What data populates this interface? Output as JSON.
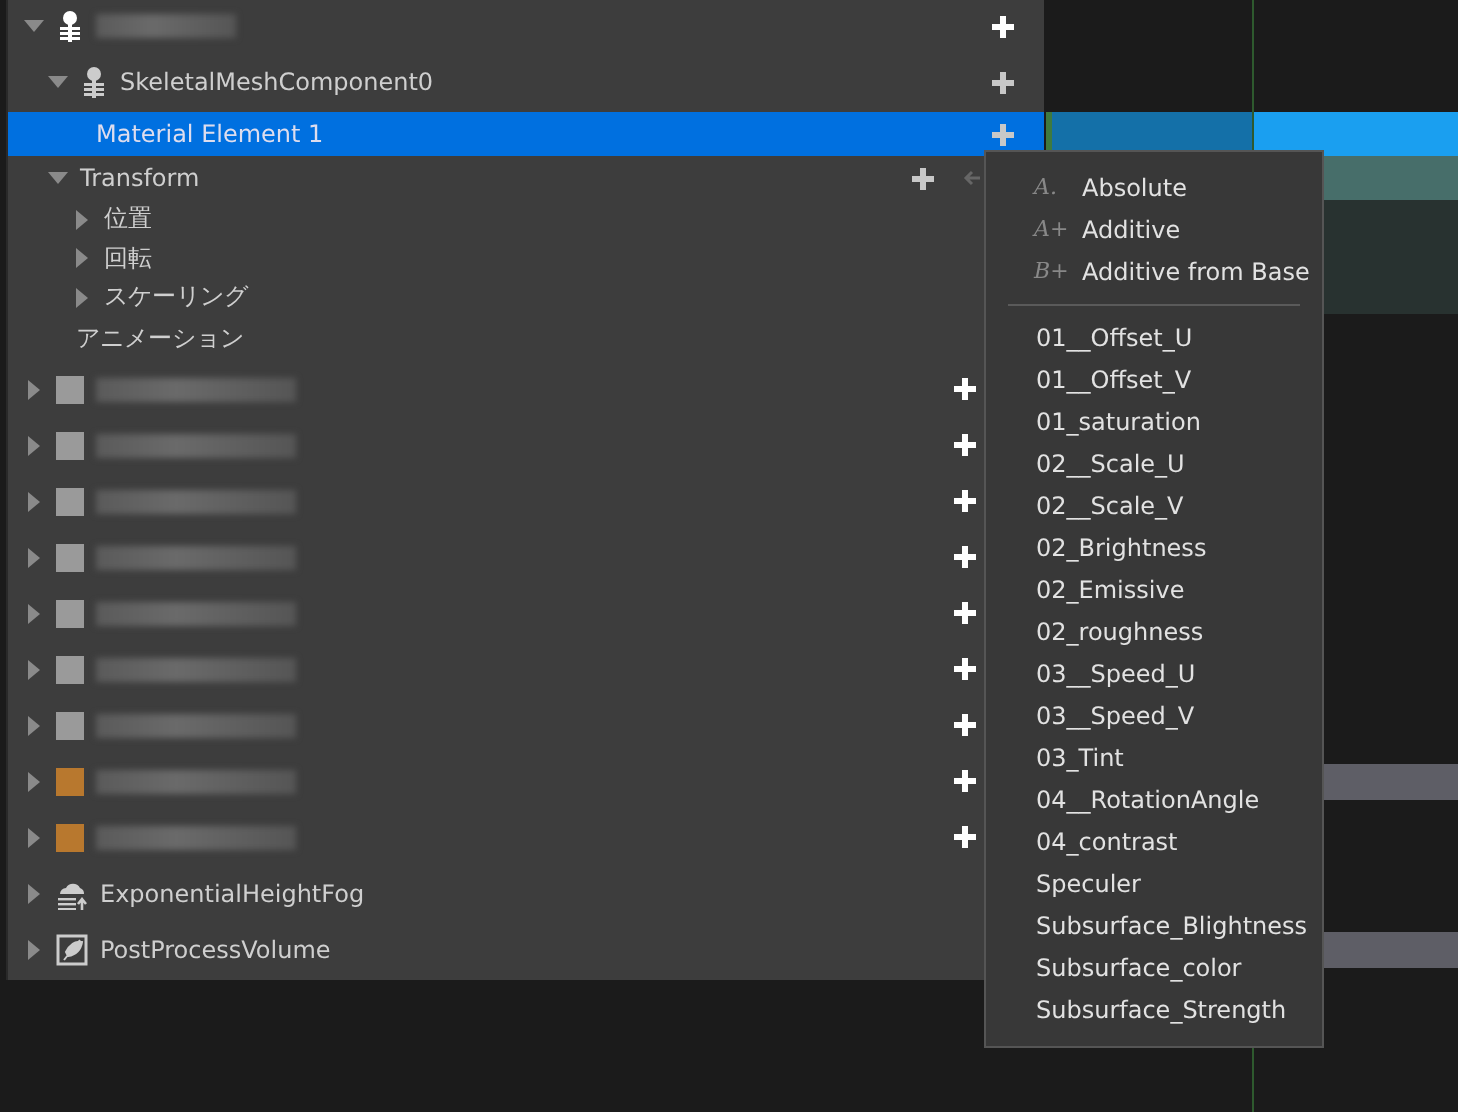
{
  "tree": [
    {
      "kind": "actor",
      "expanded": true,
      "selected": false,
      "children": [
        {
          "kind": "skeletal",
          "label": "SkeletalMeshComponent0",
          "expanded": true,
          "selected": false,
          "children": [
            {
              "kind": "leaf",
              "label": "Material Element 1",
              "selected": true
            }
          ]
        },
        {
          "kind": "group",
          "label": "Transform",
          "expanded": true,
          "selected": false,
          "children": [
            {
              "kind": "sub",
              "label": "位置",
              "expanded": false,
              "selected": false
            },
            {
              "kind": "sub",
              "label": "回転",
              "expanded": false,
              "selected": false
            },
            {
              "kind": "sub",
              "label": "スケーリング",
              "expanded": false,
              "selected": false
            }
          ]
        },
        {
          "kind": "plain",
          "label": "アニメーション",
          "selected": false
        }
      ]
    },
    {
      "kind": "redacted",
      "expanded": false,
      "selected": false,
      "color": "#9a9a9a"
    },
    {
      "kind": "redacted",
      "expanded": false,
      "selected": false,
      "color": "#9a9a9a"
    },
    {
      "kind": "redacted",
      "expanded": false,
      "selected": false,
      "color": "#9a9a9a"
    },
    {
      "kind": "redacted",
      "expanded": false,
      "selected": false,
      "color": "#9a9a9a"
    },
    {
      "kind": "redacted",
      "expanded": false,
      "selected": false,
      "color": "#9a9a9a"
    },
    {
      "kind": "redacted",
      "expanded": false,
      "selected": false,
      "color": "#9a9a9a"
    },
    {
      "kind": "redacted",
      "expanded": false,
      "selected": false,
      "color": "#9a9a9a"
    },
    {
      "kind": "redacted",
      "expanded": false,
      "selected": false,
      "color": "#b8782e"
    },
    {
      "kind": "redacted",
      "expanded": false,
      "selected": false,
      "color": "#b8782e"
    },
    {
      "kind": "fog",
      "label": "ExponentialHeightFog",
      "expanded": false,
      "selected": false
    },
    {
      "kind": "postprocess",
      "label": "PostProcessVolume",
      "expanded": false,
      "selected": false
    }
  ],
  "menu": {
    "blend_modes": [
      {
        "glyph": "A.",
        "label": "Absolute"
      },
      {
        "glyph": "A+",
        "label": "Additive"
      },
      {
        "glyph": "B+",
        "label": "Additive from Base"
      }
    ],
    "parameters": [
      "01__Offset_U",
      "01__Offset_V",
      "01_saturation",
      "02__Scale_U",
      "02__Scale_V",
      "02_Brightness",
      "02_Emissive",
      "02_roughness",
      "03__Speed_U",
      "03__Speed_V",
      "03_Tint",
      "04__RotationAngle",
      "04_contrast",
      "Speculer",
      "Subsurface_Blightness",
      "Subsurface_color",
      "Subsurface_Strength"
    ]
  }
}
